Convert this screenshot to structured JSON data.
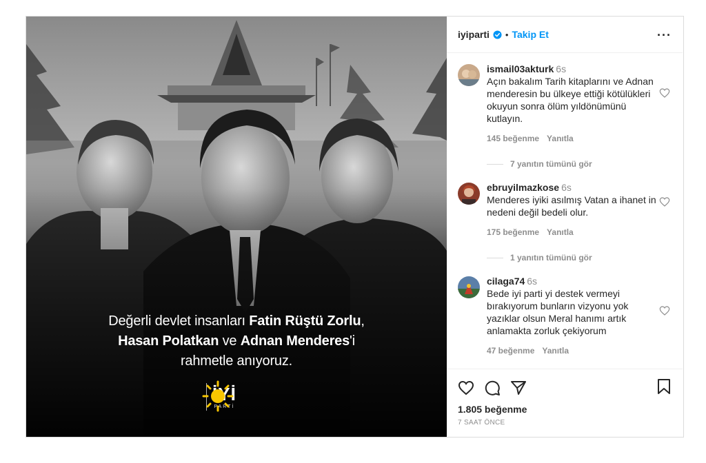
{
  "post": {
    "caption_line1_a": "Değerli devlet insanları ",
    "caption_line1_b": "Fatin Rüştü Zorlu",
    "caption_line1_c": ",",
    "caption_line2_a": "Hasan Polatkan",
    "caption_line2_b": " ve ",
    "caption_line2_c": "Adnan Menderes",
    "caption_line2_d": "'i",
    "caption_line3": "rahmetle anıyoruz.",
    "logo_word": "İYİ",
    "logo_sub": "PARTİ",
    "colors": {
      "logo_sun": "#f9c700",
      "follow": "#0095f6",
      "verified": "#0095f6"
    }
  },
  "header": {
    "username": "iyiparti",
    "separator": "•",
    "follow_label": "Takip Et",
    "more_label": "···"
  },
  "comments": [
    {
      "user": "ismail03akturk",
      "time": "6s",
      "text": "Açın bakalım Tarih kitaplarını ve Adnan menderesin bu ülkeye ettiği kötülükleri okuyun sonra ölüm yıldönümünü kutlayın.",
      "likes": "145 beğenme",
      "reply": "Yanıtla",
      "view_replies": "7 yanıtın tümünü gör"
    },
    {
      "user": "ebruyilmazkose",
      "time": "6s",
      "text": "Menderes iyiki asılmış Vatan a ihanet in nedeni değil bedeli olur.",
      "likes": "175 beğenme",
      "reply": "Yanıtla",
      "view_replies": "1 yanıtın tümünü gör"
    },
    {
      "user": "cilaga74",
      "time": "6s",
      "text": "Bede iyi parti yi destek vermeyi bırakıyorum bunların vizyonu yok yazıklar olsun Meral hanımı artık anlamakta zorluk çekiyorum",
      "likes": "47 beğenme",
      "reply": "Yanıtla"
    }
  ],
  "footer": {
    "likes": "1.805 beğenme",
    "time_ago": "7 SAAT ÖNCE"
  },
  "icons": [
    "verified-icon",
    "more-icon",
    "heart-icon",
    "comment-icon",
    "share-icon",
    "bookmark-icon"
  ]
}
